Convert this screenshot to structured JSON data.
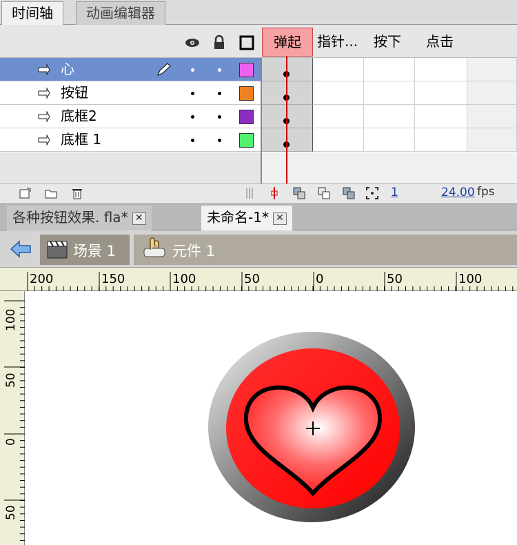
{
  "panel_tabs": [
    {
      "label": "时间轴",
      "active": true
    },
    {
      "label": "动画编辑器",
      "active": false
    }
  ],
  "timeline": {
    "column_icons": [
      "eye-icon",
      "lock-icon",
      "outline-icon"
    ],
    "frame_labels": [
      "弹起",
      "指针...",
      "按下",
      "点击"
    ],
    "layers": [
      {
        "name": "心",
        "selected": true,
        "color": "#f060f0"
      },
      {
        "name": "按钮",
        "selected": false,
        "color": "#f08020"
      },
      {
        "name": "底框2",
        "selected": false,
        "color": "#8a2ebf"
      },
      {
        "name": "底框 1",
        "selected": false,
        "color": "#50f070"
      }
    ],
    "current_frame": "1",
    "fps": "24.00",
    "fps_unit": "fps"
  },
  "document_tabs": [
    {
      "label": "各种按钮效果. fla*",
      "active": false
    },
    {
      "label": "未命名-1*",
      "active": true
    }
  ],
  "breadcrumb": {
    "scene": "场景 1",
    "symbol": "元件 1"
  },
  "rulers": {
    "top": [
      "200",
      "150",
      "100",
      "50",
      "0",
      "50",
      "100"
    ],
    "left": [
      "100",
      "50",
      "0",
      "50"
    ]
  },
  "colors": {
    "heart_fill": "#ff2020",
    "selection": "#6e8fcf",
    "playhead": "#cc0000"
  }
}
